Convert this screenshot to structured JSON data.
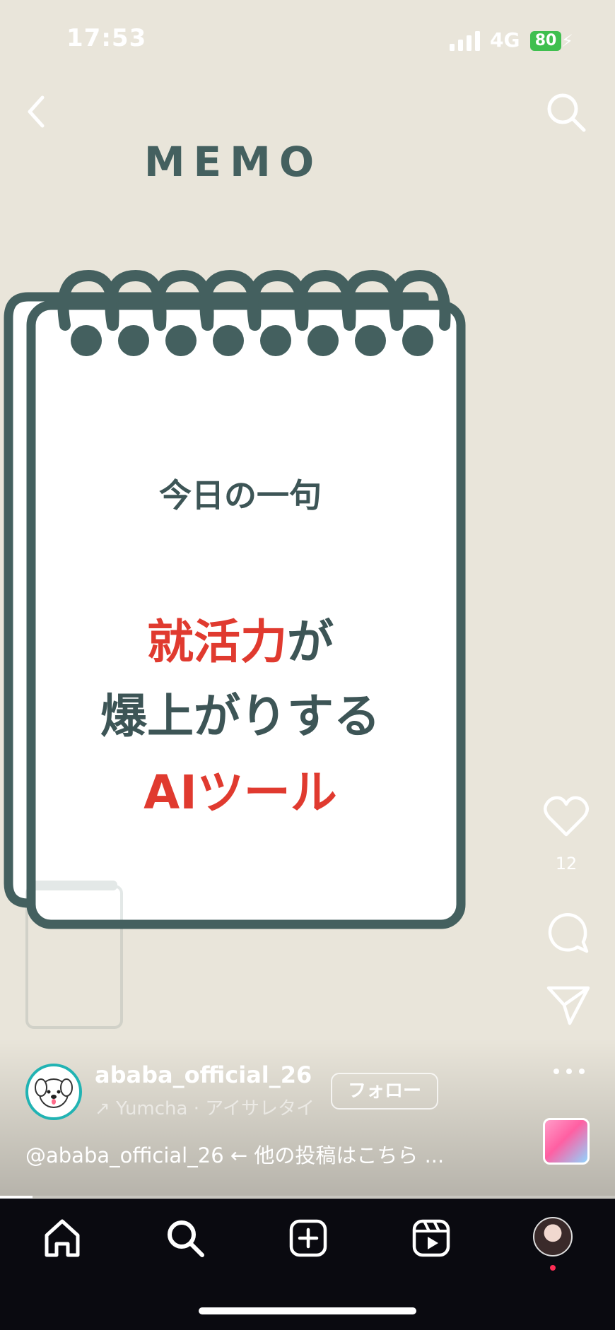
{
  "status_bar": {
    "time": "17:53",
    "network": "4G",
    "battery": "80"
  },
  "post": {
    "memo_title": "MEMO",
    "subheading": "今日の一句",
    "headline": {
      "line1_red": "就活力",
      "line1_rest": "が",
      "line2": "爆上がりする",
      "line3": "AIツール"
    }
  },
  "actions": {
    "like_count": "12"
  },
  "author": {
    "username": "ababa_official_26",
    "audio": "↗ Yumcha · アイサレタイ",
    "follow_label": "フォロー"
  },
  "caption": "@ababa_official_26 ← 他の投稿はこちら ...",
  "icons": {
    "back": "chevron-left-icon",
    "search": "search-icon",
    "like": "heart-icon",
    "comment": "comment-bubble-icon",
    "share": "paper-plane-icon",
    "more": "more-dots-icon",
    "home": "home-icon",
    "explore": "search-icon",
    "create": "plus-square-icon",
    "reels": "reels-icon"
  },
  "colors": {
    "background": "#e9e5da",
    "notebook_ink": "#44605f",
    "accent_red": "#e03a2f",
    "tabbar": "#0a0a10"
  }
}
